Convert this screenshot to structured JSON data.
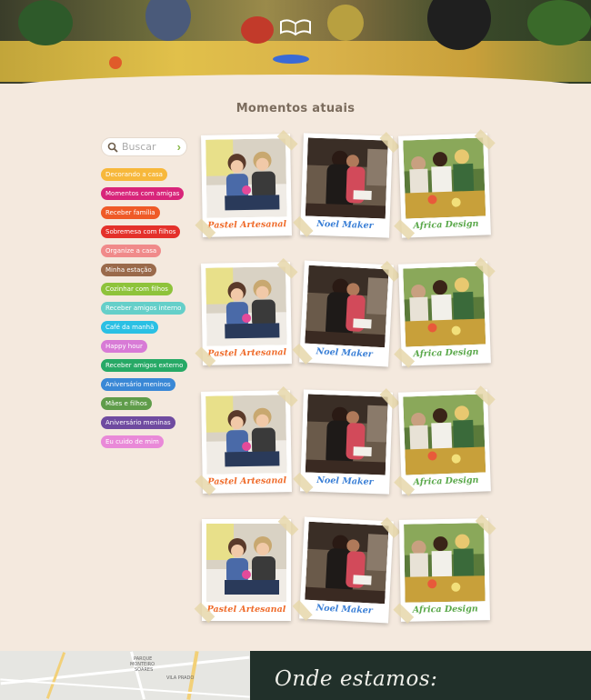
{
  "page": {
    "section_title": "Momentos atuais"
  },
  "search": {
    "placeholder": "Buscar"
  },
  "categories": [
    {
      "label": "Decorando a casa",
      "color": "#f7b83b"
    },
    {
      "label": "Momentos com amigas",
      "color": "#d8257a"
    },
    {
      "label": "Receber família",
      "color": "#ef5a27"
    },
    {
      "label": "Sobremesa com filhos",
      "color": "#e4312b"
    },
    {
      "label": "Organize a casa",
      "color": "#f08a8a"
    },
    {
      "label": "Minha estação",
      "color": "#9a6a4b"
    },
    {
      "label": "Cozinhar com filhos",
      "color": "#8ec33b"
    },
    {
      "label": "Receber amigos interno",
      "color": "#65cfc9"
    },
    {
      "label": "Café da manhã",
      "color": "#2ac0e4"
    },
    {
      "label": "Happy hour",
      "color": "#d87ad6"
    },
    {
      "label": "Receber amigos externo",
      "color": "#27a966"
    },
    {
      "label": "Aniversário meninos",
      "color": "#3a88d6"
    },
    {
      "label": "Mães e filhos",
      "color": "#5f9c4a"
    },
    {
      "label": "Aniversário meninas",
      "color": "#6f4ba0"
    },
    {
      "label": "Eu cuido de mim",
      "color": "#e989d8"
    }
  ],
  "polaroids": [
    {
      "caption": "Pastel Artesanal",
      "color": "#ef6b2a",
      "photo": "friends-knitting"
    },
    {
      "caption": "Noel Maker",
      "color": "#3a7fd6",
      "photo": "women-hugging"
    },
    {
      "caption": "Africa Design",
      "color": "#5aa84a",
      "photo": "outdoor-dinner"
    }
  ],
  "footer": {
    "heading": "Onde estamos:",
    "map_labels": [
      "PARQUE",
      "MONTEIRO",
      "SOARES",
      "VILA PRADO"
    ]
  }
}
